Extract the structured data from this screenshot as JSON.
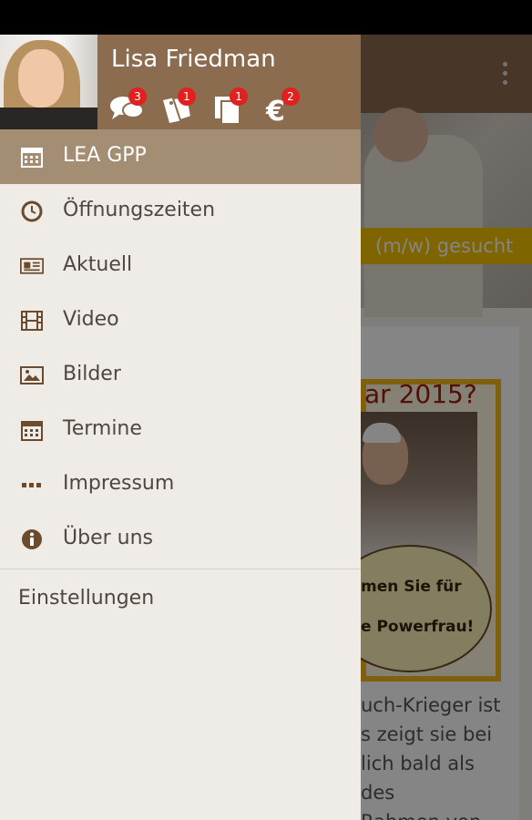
{
  "colors": {
    "header_brown": "#8c6c4f",
    "active_item": "#a38d73",
    "icon_brown": "#6b4a2e",
    "badge_red": "#e0211f",
    "drawer_bg": "#efece7"
  },
  "drawer": {
    "user": {
      "name": "Lisa Friedman",
      "badges": [
        {
          "icon": "chat-bubbles-icon",
          "count": "3"
        },
        {
          "icon": "coupon-tags-icon",
          "count": "1"
        },
        {
          "icon": "documents-icon",
          "count": "1"
        },
        {
          "icon": "euro-icon",
          "count": "2"
        }
      ]
    },
    "menu": [
      {
        "label": "LEA GPP",
        "icon": "calendar-icon",
        "active": true
      },
      {
        "label": "Öffnungszeiten",
        "icon": "clock-icon",
        "active": false
      },
      {
        "label": "Aktuell",
        "icon": "newspaper-icon",
        "active": false
      },
      {
        "label": "Video",
        "icon": "film-icon",
        "active": false
      },
      {
        "label": "Bilder",
        "icon": "image-icon",
        "active": false
      },
      {
        "label": "Termine",
        "icon": "calendar-icon",
        "active": false
      },
      {
        "label": "Impressum",
        "icon": "more-dots-icon",
        "active": false
      },
      {
        "label": "Über uns",
        "icon": "info-icon",
        "active": false
      }
    ],
    "settings_label": "Einstellungen"
  },
  "background": {
    "hero_banner_text": "(m/w) gesucht",
    "ad_title": "ar 2015?",
    "ad_line1": "men Sie für",
    "ad_line2": "e Powerfrau!",
    "article_lines": [
      "uch-Krieger ist",
      "s zeigt sie bei",
      "lich bald als",
      "des",
      "Rahmen von"
    ]
  }
}
